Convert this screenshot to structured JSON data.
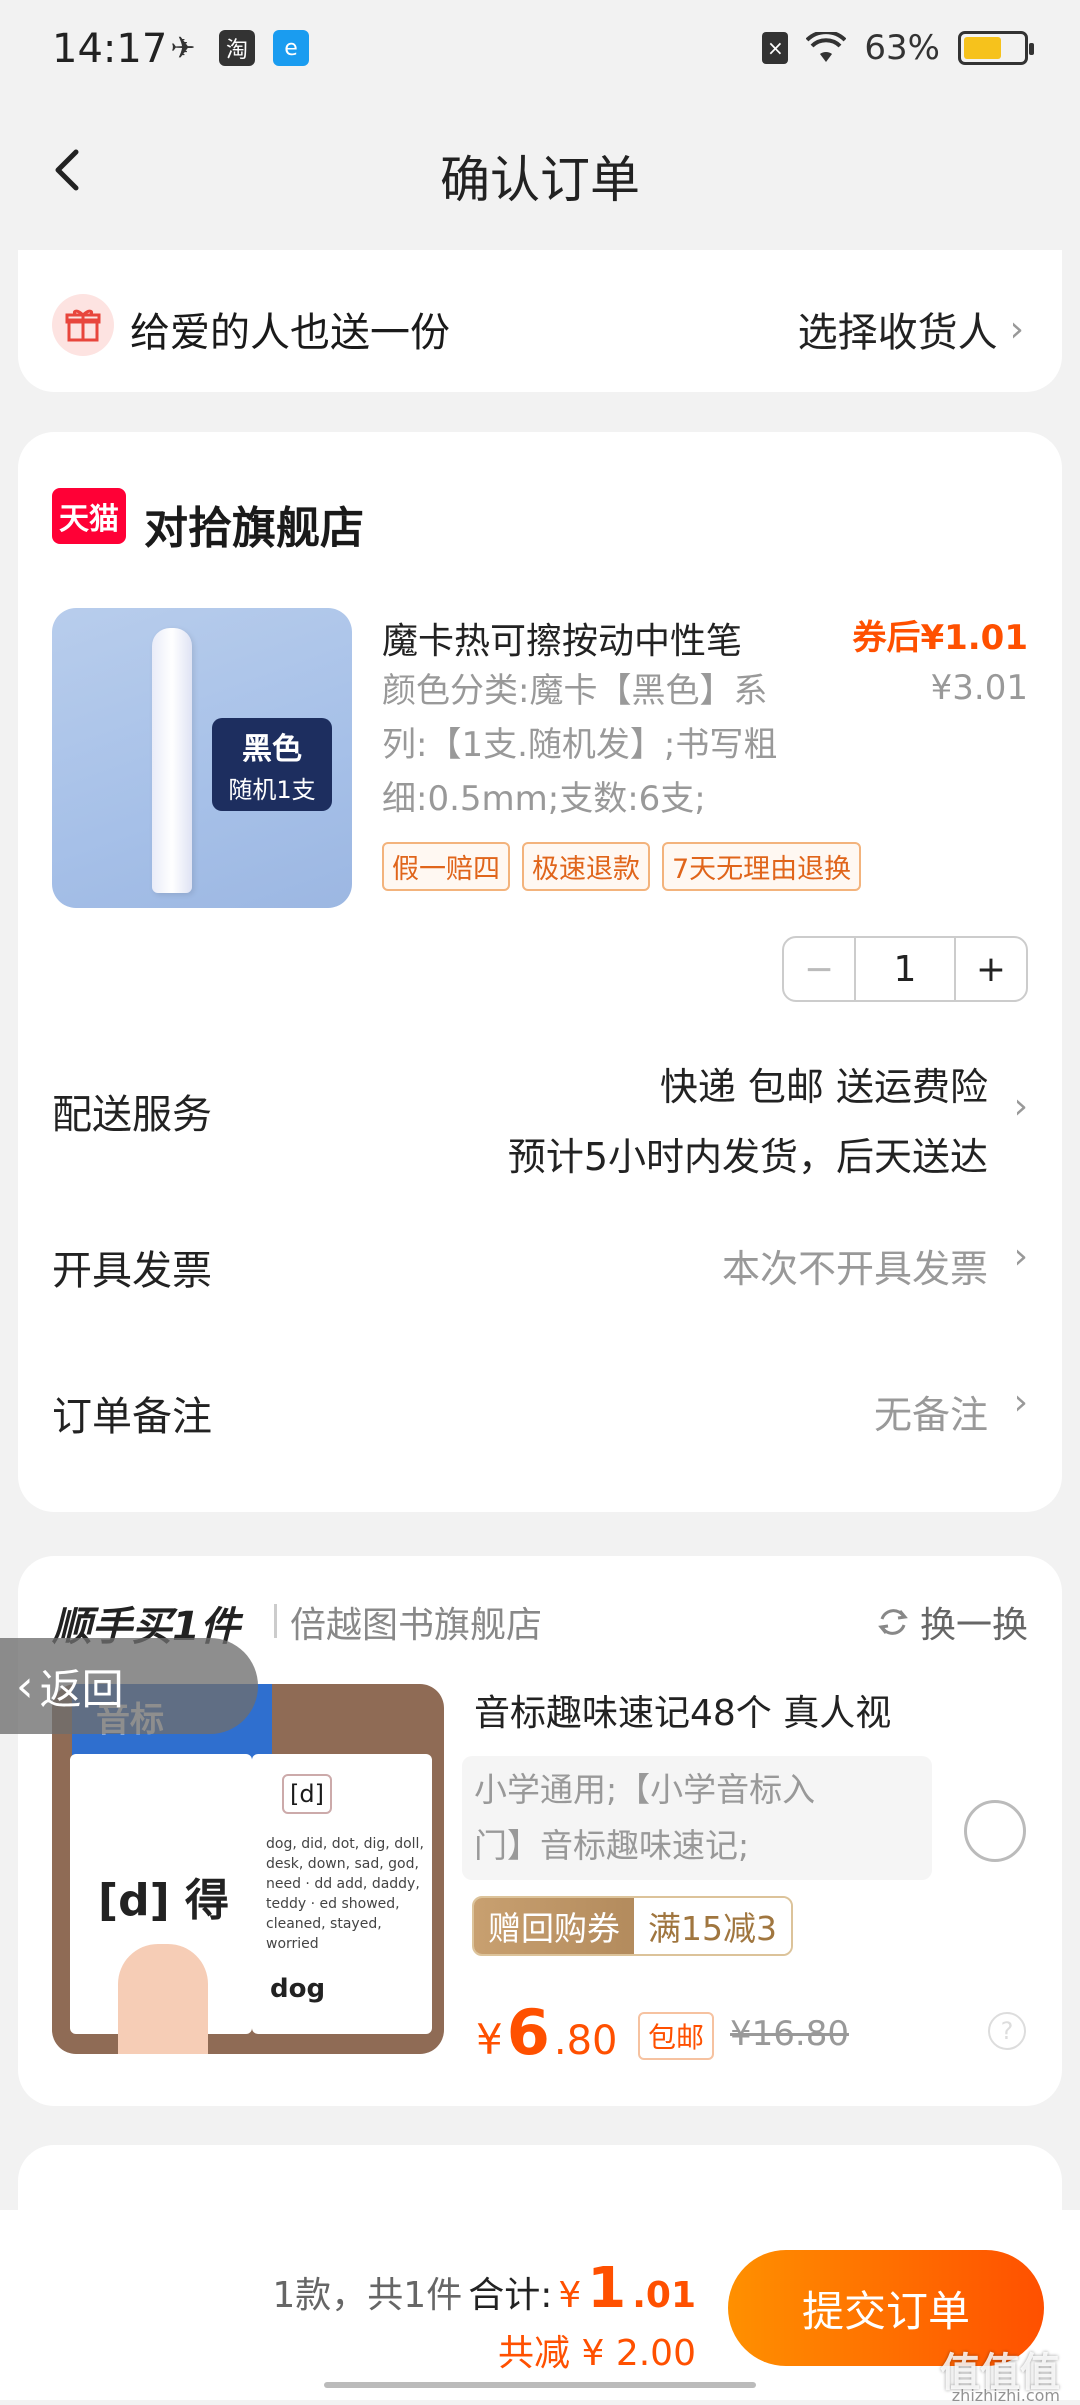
{
  "status_bar": {
    "time": "14:17",
    "battery_percent": "63%",
    "battery_level": 0.63
  },
  "header": {
    "title": "确认订单"
  },
  "gift": {
    "text": "给爱的人也送一份",
    "action": "选择收货人"
  },
  "order": {
    "shop_logo": "天猫",
    "shop_name": "对拾旗舰店",
    "product": {
      "title": "魔卡热可擦按动中性笔",
      "price_after_coupon": "券后¥1.01",
      "original_price": "¥3.01",
      "sku_lines": [
        "颜色分类:魔卡【黑色】系",
        "列:【1支.随机发】;书写粗",
        "细:0.5mm;支数:6支;"
      ],
      "image_label_1": "黑色",
      "image_label_2": "随机1支",
      "tags": [
        "假一赔四",
        "极速退款",
        "7天无理由退换"
      ]
    },
    "quantity": {
      "minus": "−",
      "value": "1",
      "plus": "+"
    },
    "delivery": {
      "label": "配送服务",
      "line1": "快递 包邮 送运费险",
      "line2": "预计5小时内发货，后天送达"
    },
    "invoice": {
      "label": "开具发票",
      "value": "本次不开具发票"
    },
    "note": {
      "label": "订单备注",
      "value": "无备注"
    }
  },
  "upsell": {
    "title": "顺手买1件",
    "shop": "倍越图书旗舰店",
    "swap": "换一换",
    "product": {
      "title": "音标趣味速记48个 真人视",
      "sku_line1": "小学通用;【小学音标入",
      "sku_line2": "门】音标趣味速记;",
      "coupon_a": "赠回购券",
      "coupon_b": "满15减3",
      "price_currency": "¥",
      "price_int": "6",
      "price_dec": ".80",
      "free_shipping": "包邮",
      "strike_price": "¥16.80",
      "image_cover": "音标",
      "image_letter": "[d] 得",
      "image_right_letter": "[d]",
      "image_right_text": "dog, did, dot, dig, doll, desk, down, sad, god, need · dd add, daddy, teddy · ed showed, cleaned, stayed, worried",
      "image_word": "dog"
    }
  },
  "float_back": {
    "label": "返回"
  },
  "bottom": {
    "count_text": "1款，共1件",
    "total_label": "合计:",
    "total_currency": "¥",
    "total_int": "1",
    "total_dec": ".01",
    "saved": "共减 ¥ 2.00",
    "submit": "提交订单",
    "watermark": "值值值",
    "watermark_sub": "zhizhizhi.com"
  },
  "colors": {
    "accent": "#ff5000",
    "tmall_red": "#ff0036",
    "background": "#f2f2f2"
  }
}
